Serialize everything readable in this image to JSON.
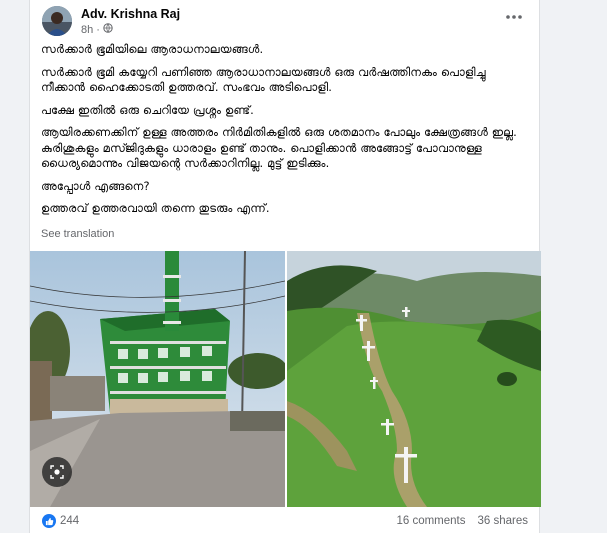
{
  "post": {
    "author": "Adv. Krishna Raj",
    "time": "8h",
    "time_separator": "·",
    "privacy_icon": "globe-icon",
    "more_icon": "more-horizontal-icon",
    "paragraphs": [
      "സർക്കാർ ഭൂമിയിലെ ആരാധനാലയങ്ങൾ.",
      "സർക്കാർ ഭൂമി കയ്യേറി പണിഞ്ഞ ആരാധാനാലയങ്ങൾ ഒരു വർഷത്തിനകം പൊളിച്ചു നീക്കാൻ ഹൈക്കോടതി ഉത്തരവ്. സംഭവം അടിപൊളി.",
      "പക്ഷേ ഇതിൽ ഒരു ചെറിയേ പ്രശ്നം ഉണ്ട്.",
      "ആയിരക്കണക്കിന് ഉള്ള അത്തരം നിർമിതികളിൽ ഒരു ശതമാനം പോലും ക്ഷേത്രങ്ങൾ ഇല്ല. കുരിശുകളും മസ്ജിദുകളും ധാരാളം ഉണ്ട് താനും. പൊളിക്കാൻ അങ്ങോട്ട് പോവാനുള്ള ധൈര്യമൊന്നും വിജയന്റെ സർക്കാറിനില്ല. മുട്ട് ഇടിക്കും.",
      "അപ്പോൾ എങ്ങനെ?",
      "ഉത്തരവ് ഉത്തരവായി തന്നെ തുടരും എന്ന്."
    ],
    "see_translation": "See translation"
  },
  "photos": {
    "left_icon": "mosque-street-photo",
    "right_icon": "hill-crosses-photo",
    "lens_icon": "visual-search-icon"
  },
  "footer": {
    "reaction_icon": "like-icon",
    "reaction_count": "244",
    "comments": "16 comments",
    "shares": "36 shares"
  },
  "colors": {
    "like_blue": "#1877f2",
    "secondary_text": "#65676b",
    "mosque_green": "#2e8b3a"
  }
}
